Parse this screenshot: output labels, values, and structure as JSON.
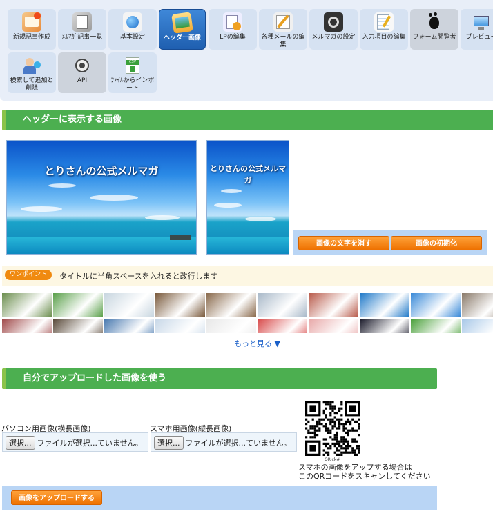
{
  "toolbar": {
    "items": [
      {
        "label": "新規記事作成",
        "icon": "new-article-icon"
      },
      {
        "label": "ﾒﾙﾏｶﾞ記事一覧",
        "icon": "article-list-icon"
      },
      {
        "label": "基本設定",
        "icon": "globe-icon"
      },
      {
        "label": "ヘッダー画像",
        "icon": "header-image-icon"
      },
      {
        "label": "LPの編集",
        "icon": "lp-edit-icon"
      },
      {
        "label": "各種メールの編集",
        "icon": "mail-edit-icon"
      },
      {
        "label": "メルマガの設定",
        "icon": "settings-icon"
      },
      {
        "label": "入力項目の編集",
        "icon": "form-fields-icon"
      },
      {
        "label": "フォーム閲覧者",
        "icon": "gnome-foot-icon"
      },
      {
        "label": "プレビュー",
        "icon": "monitor-icon"
      },
      {
        "label": "検索して追加と削除",
        "icon": "user-search-icon"
      },
      {
        "label": "API",
        "icon": "api-gear-icon"
      },
      {
        "label": "ﾌｧｲﾙからインポート",
        "icon": "csv-import-icon"
      }
    ]
  },
  "header_section": {
    "title": "ヘッダーに表示する画像",
    "banner_wide_text": "とりさんの公式メルマガ",
    "banner_narrow_text": "とりさんの公式メルマガ",
    "clear_text_button": "画像の文字を消す",
    "reset_image_button": "画像の初期化"
  },
  "tip": {
    "badge": "ワンポイント",
    "text": "タイトルに半角スペースを入れると改行します"
  },
  "gallery": {
    "more_link": "もっと見る ▼",
    "row1_colors": [
      "#6b8e4e",
      "#5aa04a",
      "#c8d6e0",
      "#7a5a3c",
      "#8a6a4c",
      "#a8b8c8",
      "#b85a4a",
      "#1e78c8",
      "#3a8ad8",
      "#8a7a6a"
    ],
    "row2_colors": [
      "#a04a4a",
      "#5a4a3a",
      "#4a7ab0",
      "#c8d8e8",
      "#e8e8e8",
      "#d84a4a",
      "#e8a8a8",
      "#1a1a2a",
      "#4aa03a",
      "#a8c8e8"
    ]
  },
  "upload_section": {
    "title": "自分でアップロードした画像を使う",
    "pc_label": "パソコン用画像(横長画像)",
    "sp_label": "スマホ用画像(縦長画像)",
    "choose_button": "選択...",
    "no_file_text": "ファイルが選択...ていません。",
    "qr_caption": "QRick#",
    "qr_note_line1": "スマホの画像をアップする場合は",
    "qr_note_line2": "このQRコードをスキャンしてください",
    "upload_button": "画像をアップロードする"
  }
}
